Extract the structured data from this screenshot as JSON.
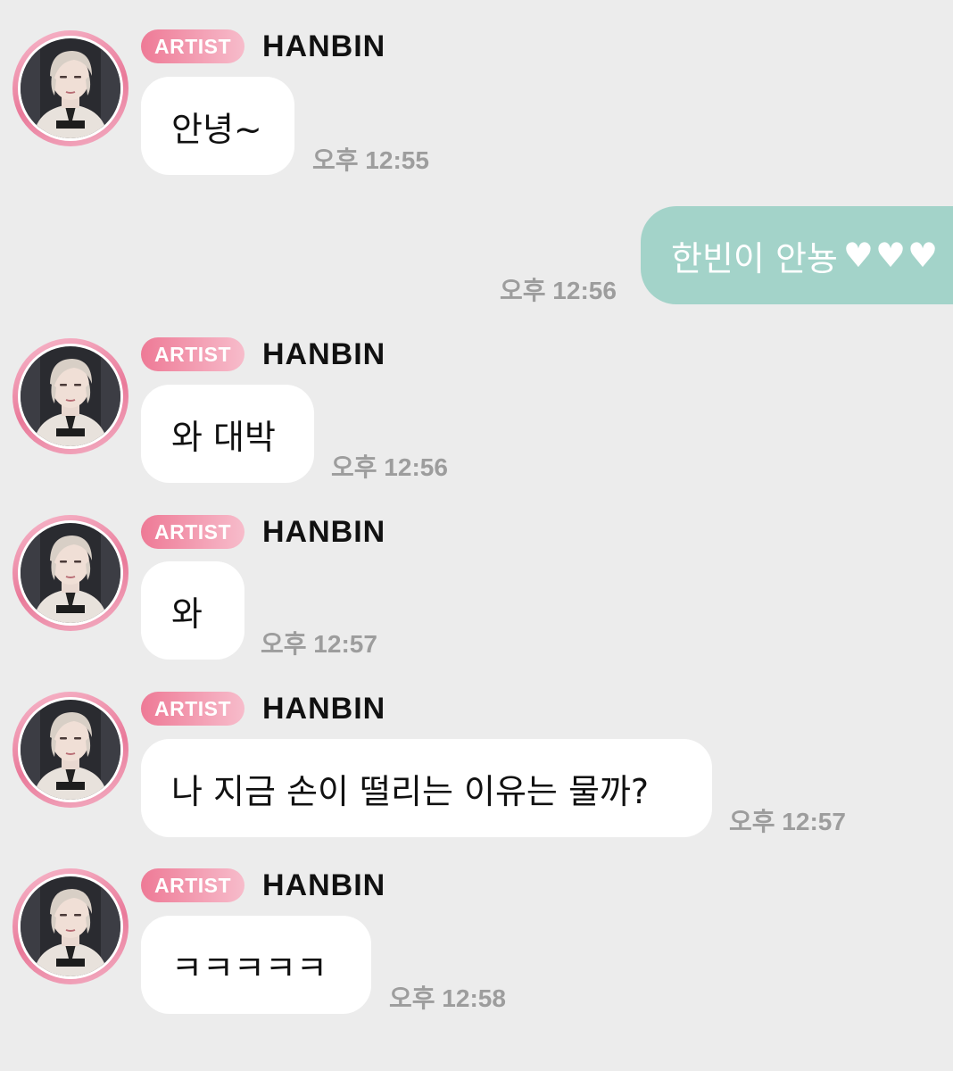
{
  "artist_badge": "ARTIST",
  "sender_name": "HANBIN",
  "messages": [
    {
      "from": "artist",
      "text": "안녕~",
      "time": "오후 12:55"
    },
    {
      "from": "me",
      "text": "한빈이 안뇽",
      "hearts": "♥♥♥",
      "time": "오후 12:56"
    },
    {
      "from": "artist",
      "text": "와 대박",
      "time": "오후 12:56"
    },
    {
      "from": "artist",
      "text": "와",
      "time": "오후 12:57"
    },
    {
      "from": "artist",
      "text": "나 지금 손이 떨리는 이유는 물까?",
      "time": "오후 12:57"
    },
    {
      "from": "artist",
      "text": "ㅋㅋㅋㅋㅋ",
      "time": "오후 12:58"
    }
  ],
  "colors": {
    "background": "#ececec",
    "artist_bubble": "#ffffff",
    "my_bubble": "#a3d3c9",
    "badge_start": "#ee7a96",
    "badge_end": "#f7bccb",
    "time_text": "#9d9d9d"
  }
}
